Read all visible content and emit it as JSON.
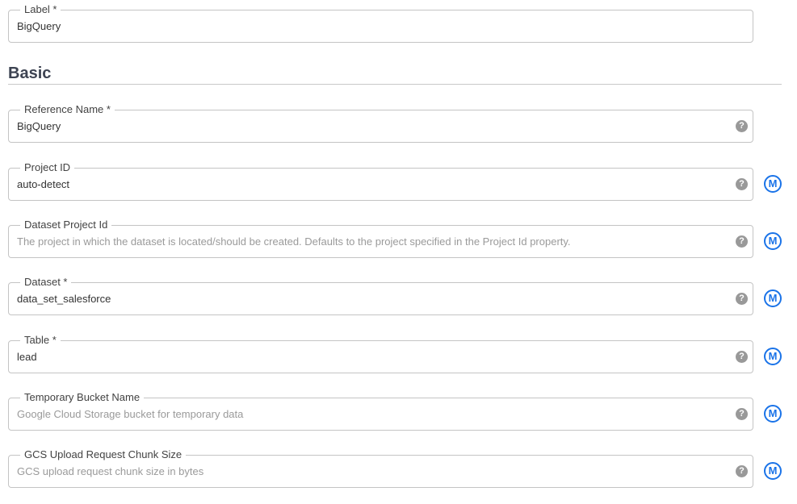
{
  "label_field": {
    "label": "Label *",
    "value": "BigQuery"
  },
  "section": {
    "title": "Basic"
  },
  "fields": [
    {
      "label": "Reference Name *",
      "value": "BigQuery",
      "placeholder": "",
      "has_macro": false
    },
    {
      "label": "Project ID",
      "value": "auto-detect",
      "placeholder": "",
      "has_macro": true
    },
    {
      "label": "Dataset Project Id",
      "value": "",
      "placeholder": "The project in which the dataset is located/should be created. Defaults to the project specified in the Project Id property.",
      "has_macro": true
    },
    {
      "label": "Dataset *",
      "value": "data_set_salesforce",
      "placeholder": "",
      "has_macro": true
    },
    {
      "label": "Table *",
      "value": "lead",
      "placeholder": "",
      "has_macro": true
    },
    {
      "label": "Temporary Bucket Name",
      "value": "",
      "placeholder": "Google Cloud Storage bucket for temporary data",
      "has_macro": true
    },
    {
      "label": "GCS Upload Request Chunk Size",
      "value": "",
      "placeholder": "GCS upload request chunk size in bytes",
      "has_macro": true
    }
  ],
  "icons": {
    "help": "question-circle-icon",
    "help_glyph": "?",
    "macro": "macro-m-icon",
    "macro_glyph": "M"
  },
  "colors": {
    "macro_blue": "#1a73e8",
    "help_gray": "#999999",
    "border": "#c4c4c4"
  }
}
